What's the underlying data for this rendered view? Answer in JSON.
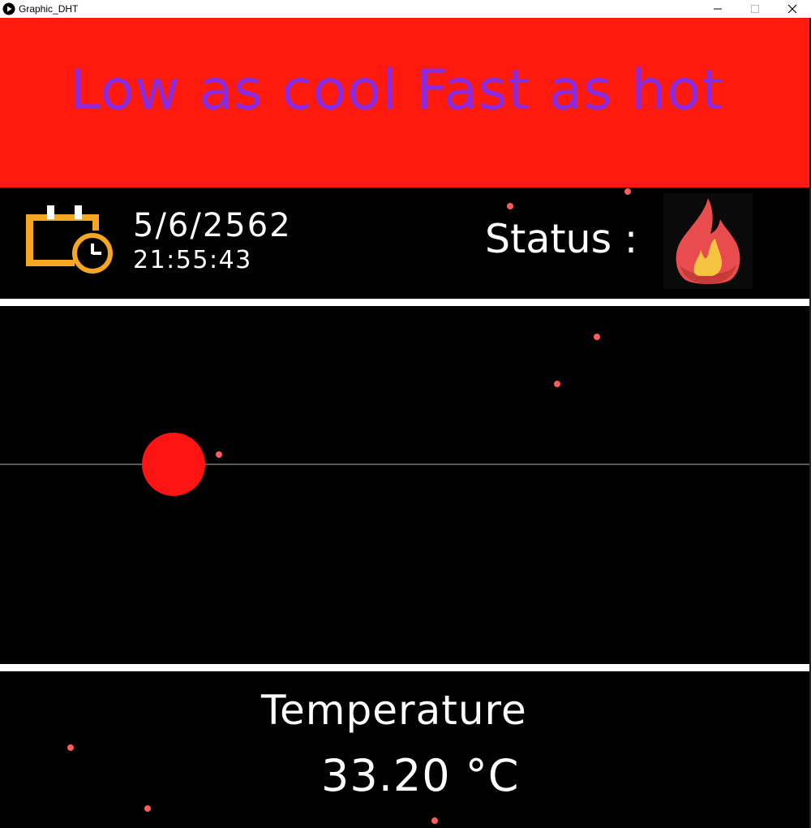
{
  "window": {
    "title": "Graphic_DHT",
    "icon": "play-circle-icon",
    "controls": [
      "minimize-icon",
      "maximize-icon",
      "close-icon"
    ]
  },
  "banner": {
    "text": "Low as cool Fast as hot",
    "background": "#ff1a0d",
    "text_color": "#8a2be2"
  },
  "clock": {
    "icon": "calendar-clock-icon",
    "icon_color": "#f5a623",
    "date": "5/6/2562",
    "time": "21:55:43"
  },
  "status": {
    "label": "Status :",
    "icon": "fire-icon"
  },
  "temperature": {
    "label": "Temperature",
    "value": "33.20 °C"
  },
  "colors": {
    "background": "#000000",
    "particle": "#ff5c5c",
    "ball": "#ff1414",
    "divider": "#ffffff"
  }
}
